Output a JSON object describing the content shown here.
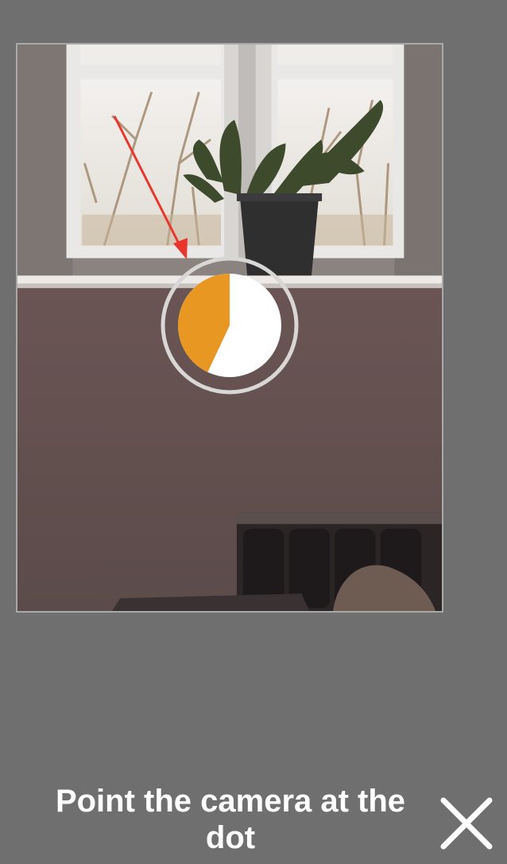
{
  "capture": {
    "progress": 0.43,
    "progress_fill_color": "#e89723",
    "progress_empty_color": "#ffffff",
    "ring_color": "#d9d6d6"
  },
  "annotation": {
    "arrow_color": "#e8362d"
  },
  "instruction": {
    "text": "Point the camera at the dot"
  },
  "close_button": {
    "icon": "close-icon",
    "color": "#ffffff"
  }
}
